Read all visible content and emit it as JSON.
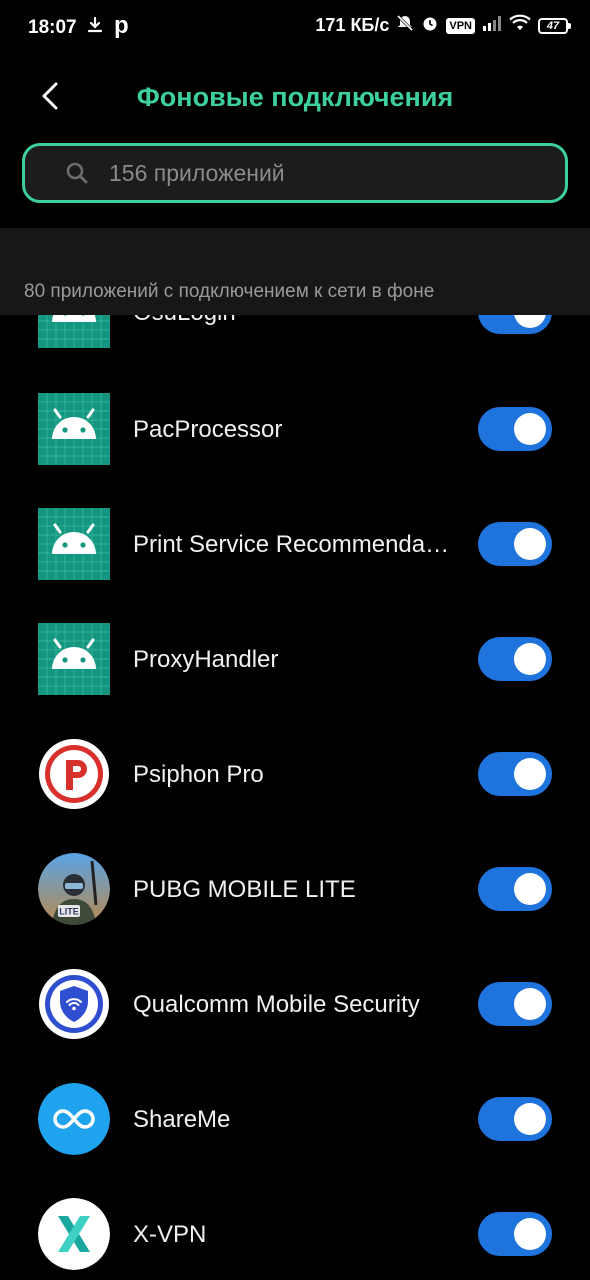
{
  "status_bar": {
    "time": "18:07",
    "p_icon_text": "p",
    "speed": "171 КБ/с",
    "vpn": "VPN",
    "battery": "47"
  },
  "header": {
    "title": "Фоновые подключения"
  },
  "search": {
    "placeholder": "156 приложений"
  },
  "section": {
    "caption": "80 приложений с подключением к сети в фоне"
  },
  "apps": [
    {
      "name": "OsuLogin",
      "icon": "android-icon",
      "enabled": true
    },
    {
      "name": "PacProcessor",
      "icon": "android-icon",
      "enabled": true
    },
    {
      "name": "Print Service Recommenda…",
      "icon": "android-icon",
      "enabled": true
    },
    {
      "name": "ProxyHandler",
      "icon": "android-icon",
      "enabled": true
    },
    {
      "name": "Psiphon Pro",
      "icon": "psiphon-icon",
      "enabled": true
    },
    {
      "name": "PUBG MOBILE LITE",
      "icon": "pubg-icon",
      "enabled": true
    },
    {
      "name": "Qualcomm Mobile Security",
      "icon": "qualcomm-security-icon",
      "enabled": true
    },
    {
      "name": "ShareMe",
      "icon": "shareme-icon",
      "enabled": true
    },
    {
      "name": "X-VPN",
      "icon": "xvpn-icon",
      "enabled": true
    }
  ],
  "colors": {
    "accent": "#3ecf9e",
    "toggle_on": "#1f73dc",
    "android_bg": "#159680"
  }
}
